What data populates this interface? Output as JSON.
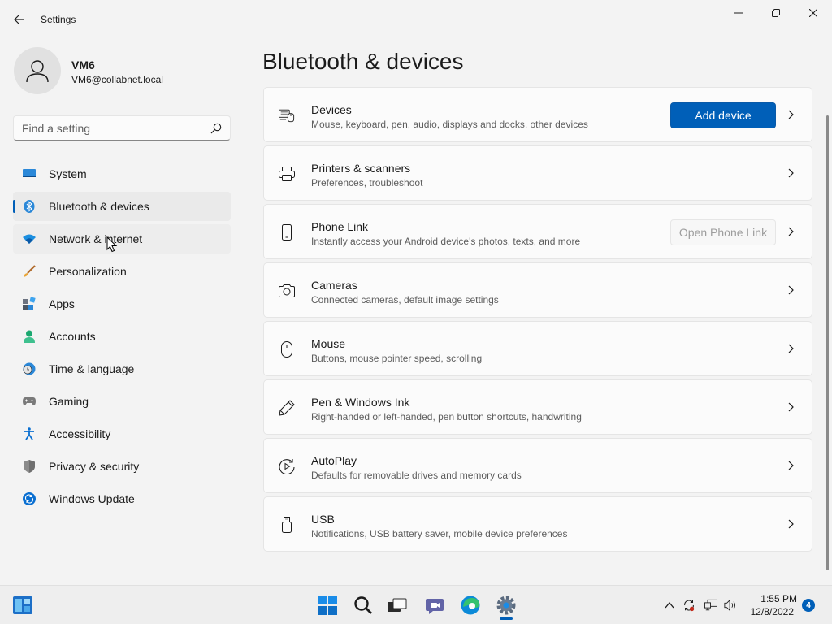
{
  "window": {
    "title": "Settings"
  },
  "profile": {
    "name": "VM6",
    "email": "VM6@collabnet.local"
  },
  "search": {
    "placeholder": "Find a setting",
    "value": ""
  },
  "sidebar": {
    "items": [
      {
        "label": "System",
        "icon": "monitor-icon",
        "state": "normal"
      },
      {
        "label": "Bluetooth & devices",
        "icon": "bluetooth-icon",
        "state": "selected"
      },
      {
        "label": "Network & internet",
        "icon": "wifi-icon",
        "state": "hover"
      },
      {
        "label": "Personalization",
        "icon": "brush-icon",
        "state": "normal"
      },
      {
        "label": "Apps",
        "icon": "apps-icon",
        "state": "normal"
      },
      {
        "label": "Accounts",
        "icon": "person-icon",
        "state": "normal"
      },
      {
        "label": "Time & language",
        "icon": "globe-clock-icon",
        "state": "normal"
      },
      {
        "label": "Gaming",
        "icon": "gamepad-icon",
        "state": "normal"
      },
      {
        "label": "Accessibility",
        "icon": "accessibility-icon",
        "state": "normal"
      },
      {
        "label": "Privacy & security",
        "icon": "shield-icon",
        "state": "normal"
      },
      {
        "label": "Windows Update",
        "icon": "update-icon",
        "state": "normal"
      }
    ]
  },
  "main": {
    "title": "Bluetooth & devices",
    "cards": [
      {
        "title": "Devices",
        "desc": "Mouse, keyboard, pen, audio, displays and docks, other devices",
        "icon": "devices-icon",
        "button": "Add device",
        "button_state": "primary"
      },
      {
        "title": "Printers & scanners",
        "desc": "Preferences, troubleshoot",
        "icon": "printer-icon"
      },
      {
        "title": "Phone Link",
        "desc": "Instantly access your Android device's photos, texts, and more",
        "icon": "phone-icon",
        "button": "Open Phone Link",
        "button_state": "disabled"
      },
      {
        "title": "Cameras",
        "desc": "Connected cameras, default image settings",
        "icon": "camera-icon"
      },
      {
        "title": "Mouse",
        "desc": "Buttons, mouse pointer speed, scrolling",
        "icon": "mouse-icon"
      },
      {
        "title": "Pen & Windows Ink",
        "desc": "Right-handed or left-handed, pen button shortcuts, handwriting",
        "icon": "pen-icon"
      },
      {
        "title": "AutoPlay",
        "desc": "Defaults for removable drives and memory cards",
        "icon": "autoplay-icon"
      },
      {
        "title": "USB",
        "desc": "Notifications, USB battery saver, mobile device preferences",
        "icon": "usb-icon"
      }
    ]
  },
  "taskbar": {
    "apps": [
      "widgets-icon",
      "start-icon",
      "search-icon",
      "task-view-icon",
      "teams-chat-icon",
      "edge-icon",
      "settings-icon"
    ],
    "active_app": "settings-icon",
    "clock": {
      "time": "1:55 PM",
      "date": "12/8/2022"
    },
    "notifications": "4"
  },
  "colors": {
    "accent": "#005fb8",
    "background": "#f3f3f3",
    "card": "#fbfbfb"
  }
}
